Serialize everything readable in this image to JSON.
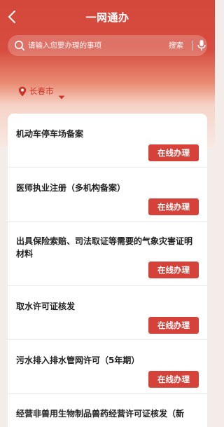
{
  "header": {
    "title": "一网通办"
  },
  "search": {
    "placeholder": "请输入您要办理的事项",
    "button_label": "搜索"
  },
  "location": {
    "label": "长春市"
  },
  "services": [
    {
      "title": "机动车停车场备案",
      "action": "在线办理"
    },
    {
      "title": "医师执业注册（多机构备案）",
      "action": "在线办理"
    },
    {
      "title": "出具保险索赔、司法取证等需要的气象灾害证明材料",
      "action": "在线办理"
    },
    {
      "title": "取水许可证核发",
      "action": "在线办理"
    },
    {
      "title": "污水排入排水管网许可（5年期）",
      "action": "在线办理"
    },
    {
      "title": "经营非兽用生物制品兽药经营许可证核发（新"
    }
  ],
  "colors": {
    "brand_red": "#d5423a",
    "header_red": "#d4483b",
    "location_red": "#c8362b"
  },
  "icons": {
    "back": "back-arrow-icon",
    "search": "search-icon",
    "mic": "microphone-icon",
    "location": "map-pin-icon",
    "dropdown": "caret-down-icon"
  }
}
